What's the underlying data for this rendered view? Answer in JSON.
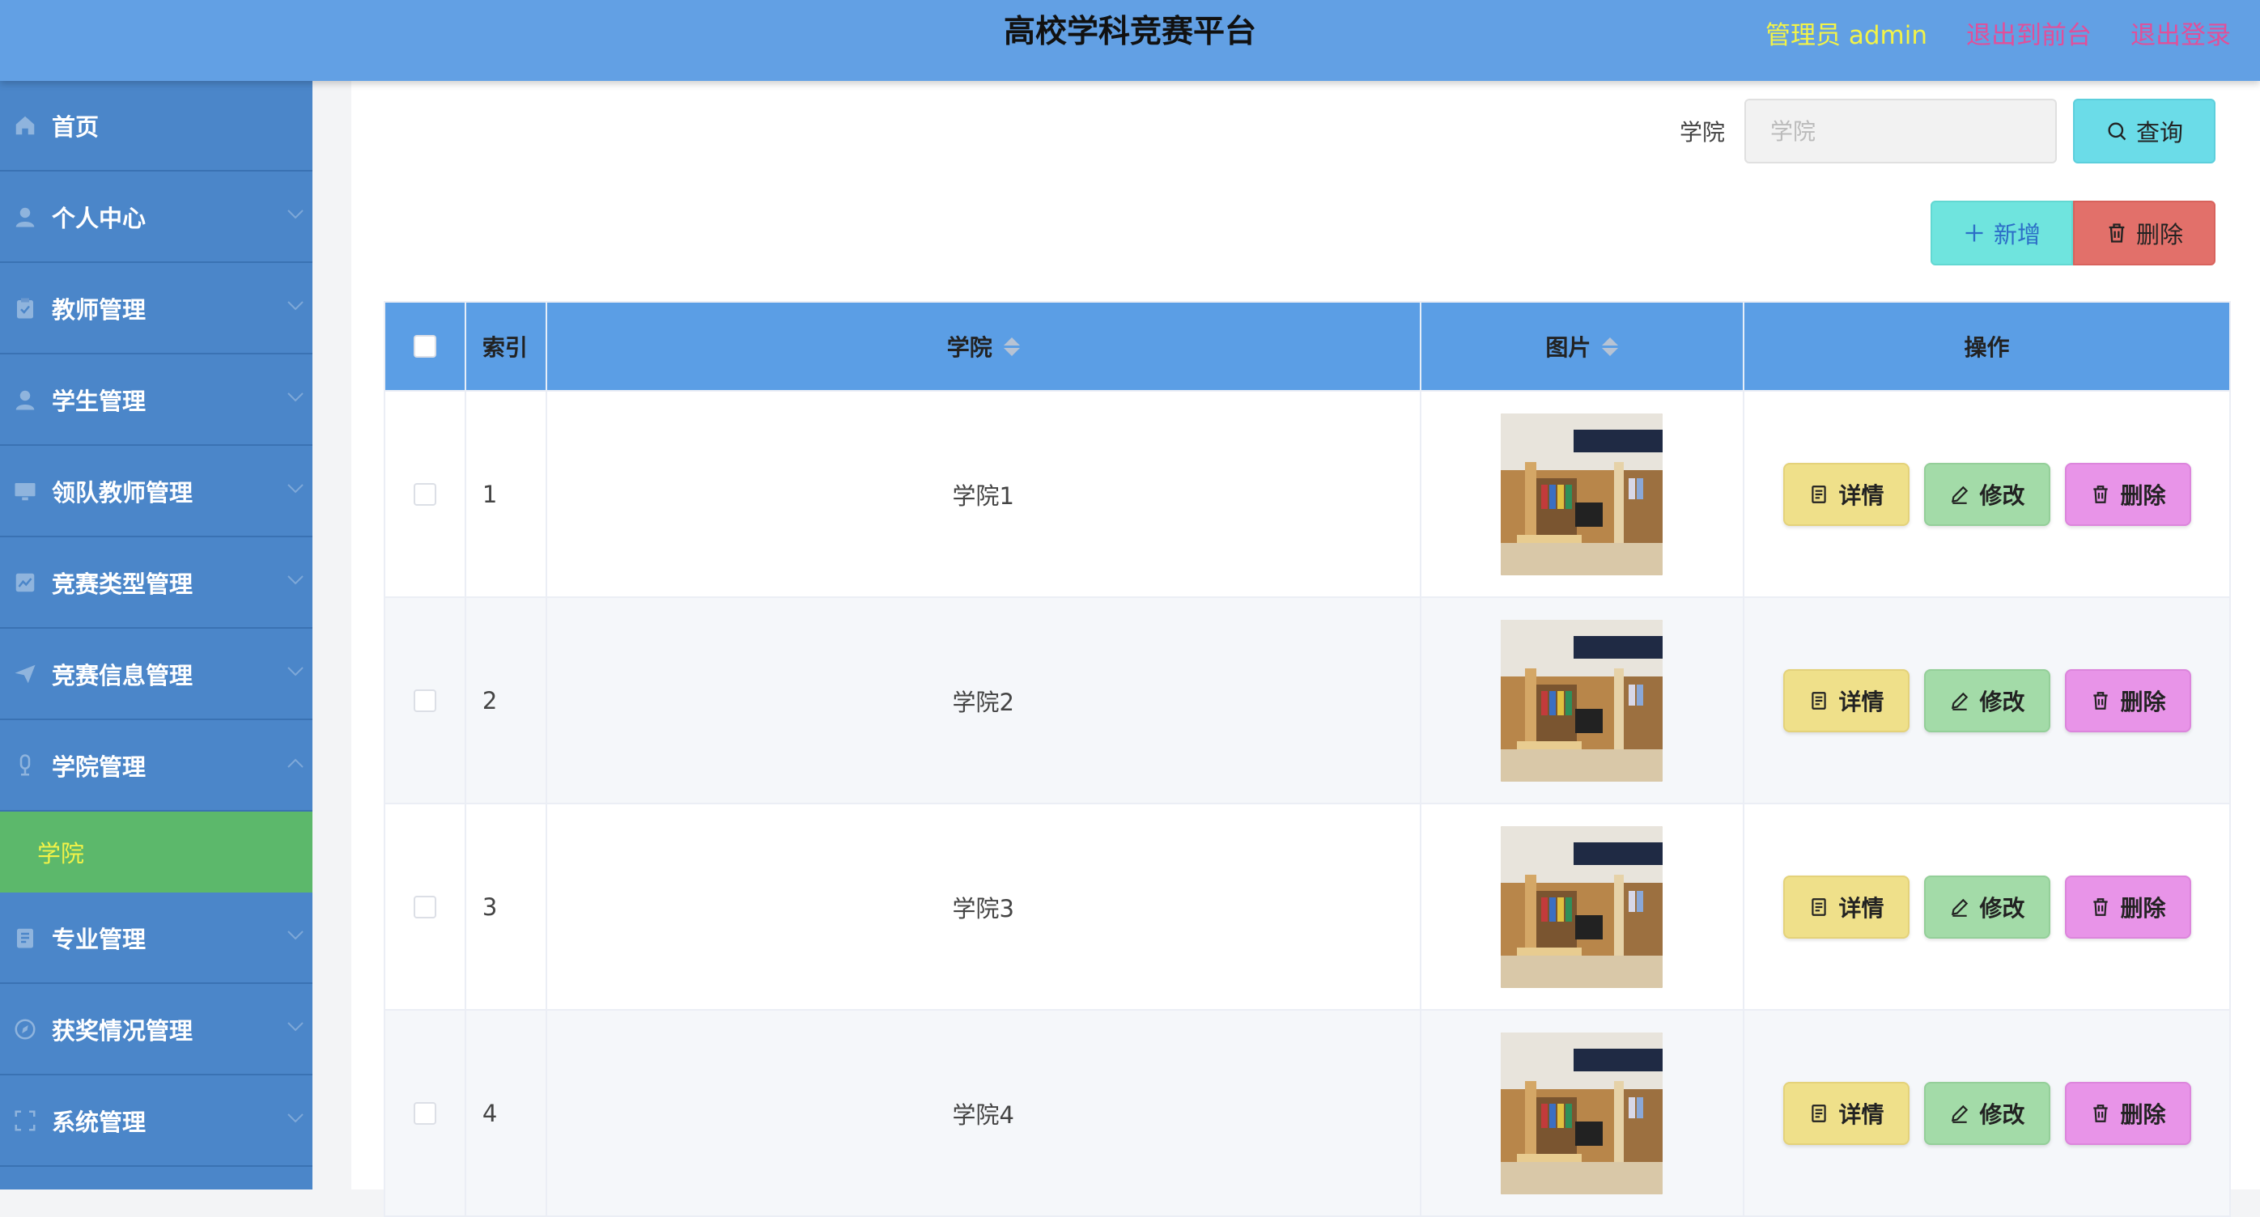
{
  "header": {
    "title": "高校学科竞赛平台",
    "admin": "管理员 admin",
    "to_front": "退出到前台",
    "logout": "退出登录"
  },
  "sidebar": {
    "items": [
      {
        "label": "首页",
        "icon": "home-icon"
      },
      {
        "label": "个人中心",
        "icon": "user-icon"
      },
      {
        "label": "教师管理",
        "icon": "clipboard-icon"
      },
      {
        "label": "学生管理",
        "icon": "user-icon"
      },
      {
        "label": "领队教师管理",
        "icon": "monitor-icon"
      },
      {
        "label": "竞赛类型管理",
        "icon": "chart-icon"
      },
      {
        "label": "竞赛信息管理",
        "icon": "send-icon"
      },
      {
        "label": "学院管理",
        "icon": "mic-icon"
      },
      {
        "label": "专业管理",
        "icon": "notebook-icon"
      },
      {
        "label": "获奖情况管理",
        "icon": "compass-icon"
      },
      {
        "label": "系统管理",
        "icon": "frame-icon"
      }
    ],
    "submenu_active": "学院"
  },
  "search": {
    "label": "学院",
    "placeholder": "学院",
    "value": "",
    "query_label": "查询"
  },
  "actions": {
    "add_label": "新增",
    "delete_label": "删除"
  },
  "table": {
    "headers": {
      "index": "索引",
      "college": "学院",
      "image": "图片",
      "ops": "操作"
    },
    "rows": [
      {
        "index": "1",
        "college": "学院1"
      },
      {
        "index": "2",
        "college": "学院2"
      },
      {
        "index": "3",
        "college": "学院3"
      },
      {
        "index": "4",
        "college": "学院4"
      }
    ],
    "ops": {
      "detail": "详情",
      "edit": "修改",
      "delete": "删除"
    }
  }
}
